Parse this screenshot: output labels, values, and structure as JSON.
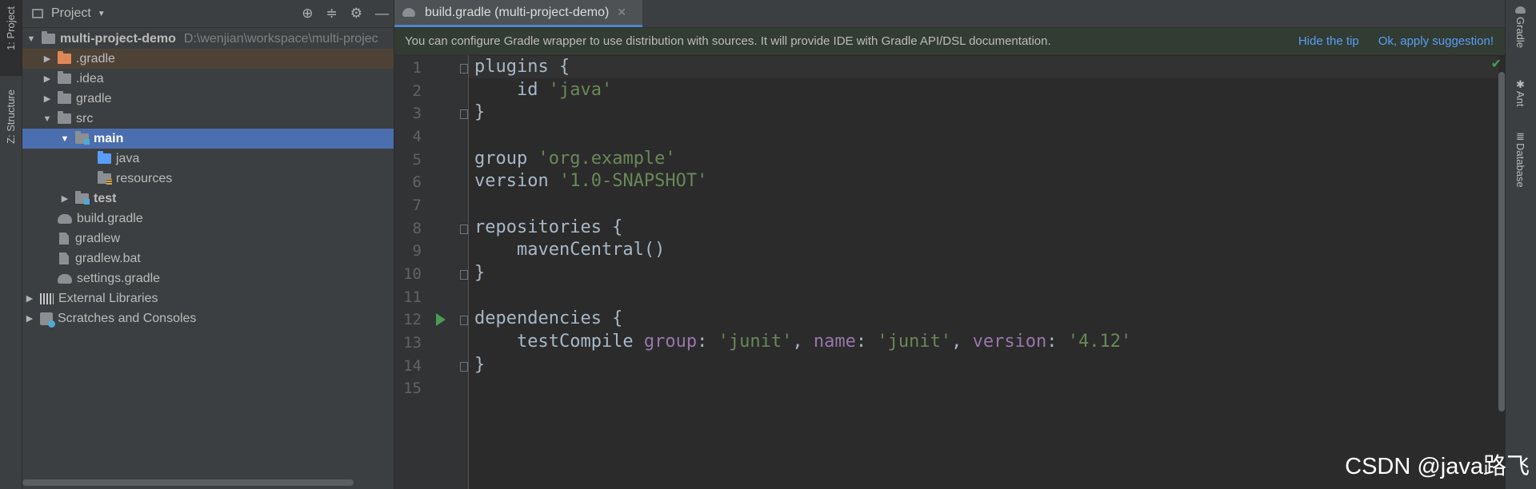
{
  "left_strip": {
    "project_tab": "1: Project",
    "structure_tab": "Z: Structure"
  },
  "right_strip": {
    "gradle_tab": "Gradle",
    "ant_tab": "Ant",
    "database_tab": "Database"
  },
  "project_panel": {
    "title": "Project",
    "tree": [
      {
        "label": "multi-project-demo",
        "path": "D:\\wenjian\\workspace\\multi-projec"
      },
      {
        "label": ".gradle"
      },
      {
        "label": ".idea"
      },
      {
        "label": "gradle"
      },
      {
        "label": "src"
      },
      {
        "label": "main"
      },
      {
        "label": "java"
      },
      {
        "label": "resources"
      },
      {
        "label": "test"
      },
      {
        "label": "build.gradle"
      },
      {
        "label": "gradlew"
      },
      {
        "label": "gradlew.bat"
      },
      {
        "label": "settings.gradle"
      },
      {
        "label": "External Libraries"
      },
      {
        "label": "Scratches and Consoles"
      }
    ]
  },
  "editor": {
    "tab_label": "build.gradle (multi-project-demo)",
    "banner": {
      "message": "You can configure Gradle wrapper to use distribution with sources. It will provide IDE with Gradle API/DSL documentation.",
      "hide_tip": "Hide the tip",
      "apply": "Ok, apply suggestion!"
    },
    "line_numbers": [
      "1",
      "2",
      "3",
      "4",
      "5",
      "6",
      "7",
      "8",
      "9",
      "10",
      "11",
      "12",
      "13",
      "14",
      "15"
    ],
    "code": {
      "l1": "plugins {",
      "l2_a": "    id ",
      "l2_b": "'java'",
      "l3": "}",
      "l5_a": "group ",
      "l5_b": "'org.example'",
      "l6_a": "version ",
      "l6_b": "'1.0-SNAPSHOT'",
      "l8": "repositories {",
      "l9": "    mavenCentral()",
      "l10": "}",
      "l12": "dependencies {",
      "l13_a": "    testCompile ",
      "l13_b": "group",
      "l13_c": ": ",
      "l13_d": "'junit'",
      "l13_e": ", ",
      "l13_f": "name",
      "l13_g": ": ",
      "l13_h": "'junit'",
      "l13_i": ", ",
      "l13_j": "version",
      "l13_k": ": ",
      "l13_l": "'4.12'",
      "l14": "}"
    }
  },
  "watermark": "CSDN @java路飞"
}
